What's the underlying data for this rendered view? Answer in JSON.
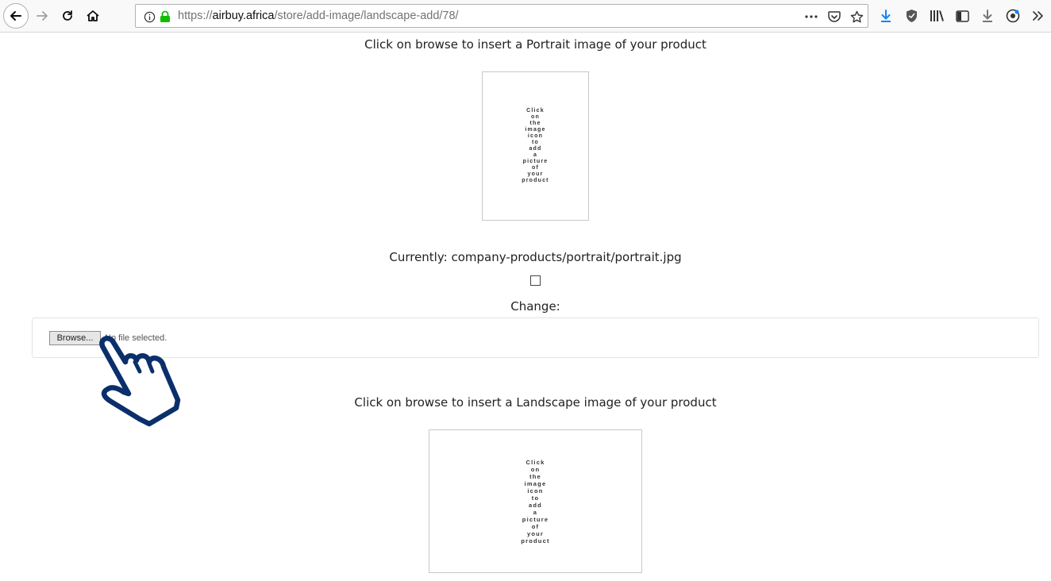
{
  "browser": {
    "url_scheme": "https://",
    "url_host": "airbuy.africa",
    "url_path": "/store/add-image/landscape-add/78/",
    "icons": [
      "back-arrow-icon",
      "forward-arrow-icon",
      "reload-icon",
      "home-icon",
      "info-icon",
      "lock-icon",
      "more-icon",
      "pocket-icon",
      "star-icon",
      "download-icon",
      "shield-icon",
      "library-icon",
      "sidebar-icon",
      "download-alt-icon",
      "account-icon",
      "overflow-icon"
    ],
    "accent_color": "#0a84ff",
    "lock_color": "#12bc00"
  },
  "page": {
    "portrait_caption": "Click on browse to insert a Portrait image of your product",
    "placeholder_words": [
      "Click",
      "on",
      "the",
      "image",
      "icon",
      "to",
      "add",
      "a",
      "picture",
      "of",
      "your",
      "product"
    ],
    "currently_label": "Currently: company-products/portrait/portrait.jpg",
    "change_label": "Change:",
    "browse_label": "Browse...",
    "file_status": "No file selected.",
    "landscape_caption": "Click on browse to insert a Landscape image of your product",
    "hand_icon": "pointing-hand-icon",
    "hand_color": "#0b2f6b"
  }
}
